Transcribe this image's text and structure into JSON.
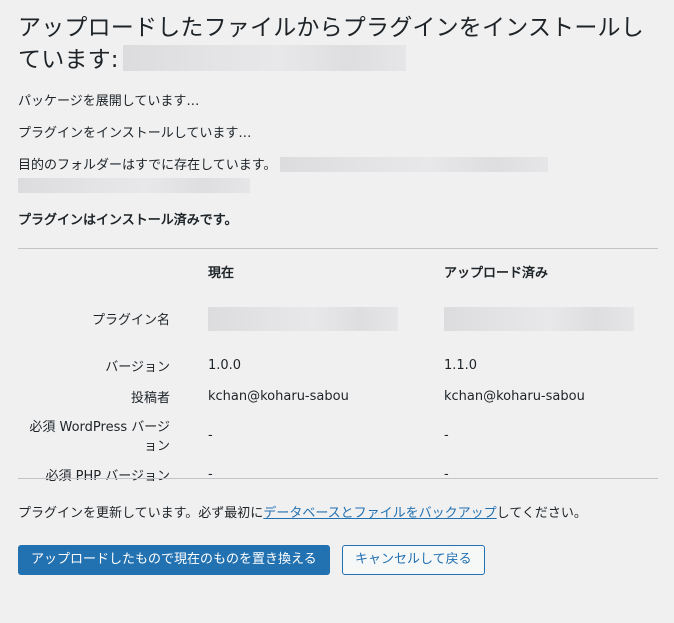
{
  "page": {
    "title": "アップロードしたファイルからプラグインをインストールしています:",
    "messages": {
      "unpacking": "パッケージを展開しています…",
      "installing": "プラグインをインストールしています…",
      "folder_exists": "目的のフォルダーはすでに存在しています。",
      "already_installed": "プラグインはインストール済みです。"
    },
    "compare": {
      "header_current": "現在",
      "header_uploaded": "アップロード済み",
      "rows": [
        {
          "label": "プラグイン名",
          "current": "",
          "uploaded": ""
        },
        {
          "label": "バージョン",
          "current": "1.0.0",
          "uploaded": "1.1.0"
        },
        {
          "label": "投稿者",
          "current": "kchan@koharu-sabou",
          "uploaded": "kchan@koharu-sabou"
        },
        {
          "label": "必須 WordPress バージョン",
          "current": "-",
          "uploaded": "-"
        },
        {
          "label": "必須 PHP バージョン",
          "current": "-",
          "uploaded": "-"
        }
      ]
    },
    "notice": {
      "prefix": "プラグインを更新しています。必ず最初に",
      "link": "データベースとファイルをバックアップ",
      "suffix": "してください。"
    },
    "buttons": {
      "replace": "アップロードしたもので現在のものを置き換える",
      "cancel": "キャンセルして戻る"
    }
  },
  "colors": {
    "background": "#f0f0f1",
    "text": "#1d2327",
    "accent": "#2271b1",
    "divider": "#c3c4c7"
  }
}
